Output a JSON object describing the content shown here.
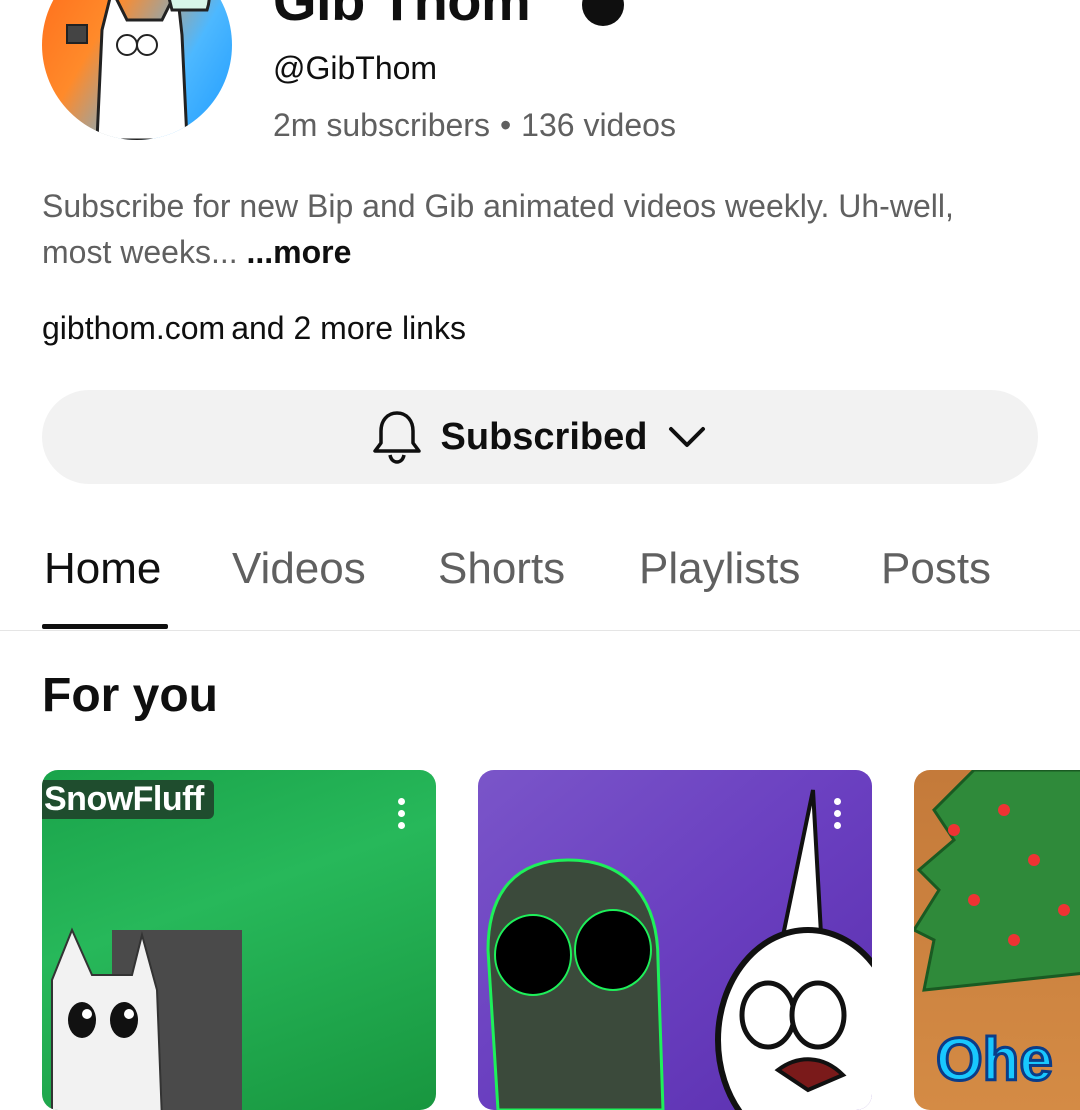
{
  "channel": {
    "name": "Gib Thom",
    "handle": "@GibThom",
    "subscribers": "2m subscribers",
    "separator": "•",
    "video_count": "136 videos",
    "description": "Subscribe for new Bip and Gib animated videos weekly. Uh-well, most weeks...",
    "more_label": "...more",
    "link_primary": "gibthom.com",
    "link_more": "and 2 more links",
    "subscribe_button_label": "Subscribed"
  },
  "tabs": [
    {
      "label": "Home",
      "active": true
    },
    {
      "label": "Videos",
      "active": false
    },
    {
      "label": "Shorts",
      "active": false
    },
    {
      "label": "Playlists",
      "active": false
    },
    {
      "label": "Posts",
      "active": false
    }
  ],
  "section": {
    "title": "For you"
  },
  "cards": [
    {
      "overlay_text": "SnowFluff"
    },
    {
      "overlay_text": ""
    },
    {
      "overlay_text": "Ohe"
    }
  ],
  "colors": {
    "text_primary": "#0f0f0f",
    "text_secondary": "#606060",
    "button_bg": "#f2f2f2"
  },
  "icons": {
    "bell": "bell-icon",
    "chevron": "chevron-down-icon",
    "verified": "verified-icon",
    "kebab": "more-vert-icon"
  }
}
